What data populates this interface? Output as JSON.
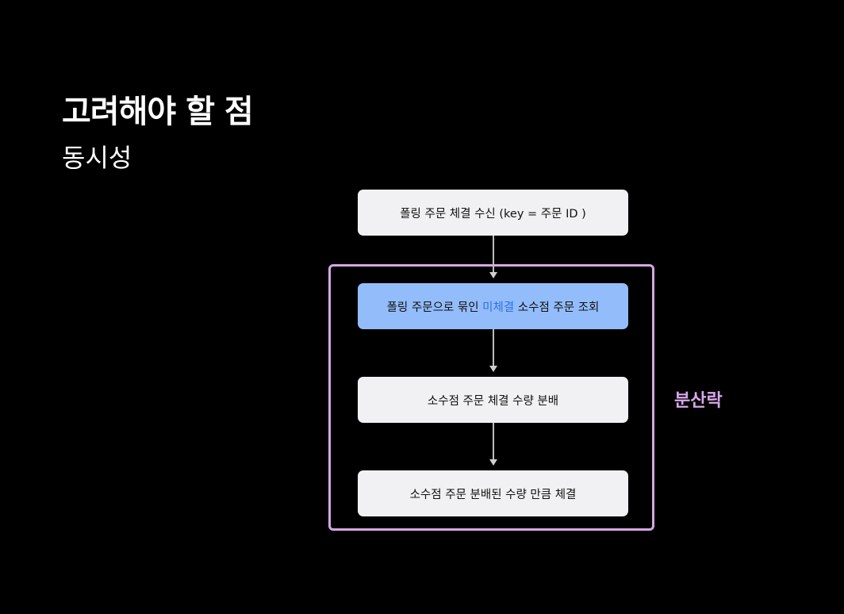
{
  "slide": {
    "title": "고려해야 할 점",
    "subtitle": "동시성"
  },
  "diagram": {
    "steps": [
      {
        "text": "폴링 주문 체결 수신 (key = 주문 ID )"
      },
      {
        "text_before": "폴링 주문으로 묶인 ",
        "highlight": "미체결",
        "text_after": " 소수점 주문 조회"
      },
      {
        "text": "소수점 주문 체결 수량 분배"
      },
      {
        "text": "소수점 주문 분배된 수량 만큼 체결"
      }
    ],
    "region_label": "분산락"
  },
  "colors": {
    "background": "#000000",
    "box": "#f1f1f3",
    "highlight_box": "#93bdfa",
    "highlight_text": "#2f6fe6",
    "region_border": "#d6a6e6",
    "region_label": "#d9a8ec"
  }
}
